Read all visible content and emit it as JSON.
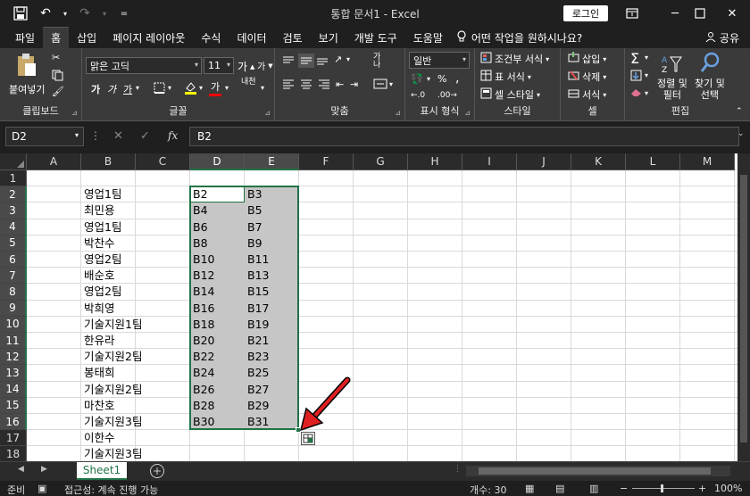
{
  "window": {
    "title": "통합 문서1 - Excel",
    "login_label": "로그인"
  },
  "ribbon": {
    "tabs": [
      "파일",
      "홈",
      "삽입",
      "페이지 레이아웃",
      "수식",
      "데이터",
      "검토",
      "보기",
      "개발 도구",
      "도움말"
    ],
    "active_tab": "홈",
    "tell_me": "어떤 작업을 원하시나요?",
    "share_label": "공유",
    "clipboard": {
      "paste_label": "붙여넣기",
      "group_label": "클립보드"
    },
    "font": {
      "font_name": "맑은 고딕",
      "font_size": "11",
      "bold": "가",
      "italic": "가",
      "underline": "가",
      "font_color_glyph": "가",
      "phonetic": "내천",
      "group_label": "글꼴"
    },
    "alignment": {
      "group_label": "맞춤",
      "wrap_glyph": "가나"
    },
    "number": {
      "format": "일반",
      "percent": "%",
      "comma": ",",
      "group_label": "표시 형식"
    },
    "styles": {
      "conditional": "조건부 서식",
      "table": "표 서식",
      "cell_style": "셀 스타일",
      "group_label": "스타일"
    },
    "cells": {
      "insert": "삽입",
      "delete": "삭제",
      "format": "서식",
      "group_label": "셀"
    },
    "editing": {
      "sort_filter": "정렬 및\n필터",
      "sort_line1": "정렬 및",
      "sort_line2": "필터",
      "find_line1": "찾기 및",
      "find_line2": "선택",
      "group_label": "편집"
    }
  },
  "formula_bar": {
    "name_box": "D2",
    "formula": "B2"
  },
  "grid": {
    "columns": [
      "A",
      "B",
      "C",
      "D",
      "E",
      "F",
      "G",
      "H",
      "I",
      "J",
      "K",
      "L",
      "M"
    ],
    "selected_columns": [
      "D",
      "E"
    ],
    "rows": [
      "1",
      "2",
      "3",
      "4",
      "5",
      "6",
      "7",
      "8",
      "9",
      "10",
      "11",
      "12",
      "13",
      "14",
      "15",
      "16",
      "17",
      "18"
    ],
    "selected_rows": [
      "2",
      "3",
      "4",
      "5",
      "6",
      "7",
      "8",
      "9",
      "10",
      "11",
      "12",
      "13",
      "14",
      "15",
      "16"
    ],
    "column_b": [
      "",
      "영업1팀",
      "최민용",
      "영업1팀",
      "박찬수",
      "영업2팀",
      "배순호",
      "영업2팀",
      "박희영",
      "기술지원1팀",
      "한유라",
      "기술지원2팀",
      "봉태희",
      "기술지원2팀",
      "마찬호",
      "기술지원3팀",
      "이한수",
      "기술지원3팀"
    ],
    "column_d": [
      "",
      "B2",
      "B4",
      "B6",
      "B8",
      "B10",
      "B12",
      "B14",
      "B16",
      "B18",
      "B20",
      "B22",
      "B24",
      "B26",
      "B28",
      "B30",
      "",
      ""
    ],
    "column_e": [
      "",
      "B3",
      "B5",
      "B7",
      "B9",
      "B11",
      "B13",
      "B15",
      "B17",
      "B19",
      "B21",
      "B23",
      "B25",
      "B27",
      "B29",
      "B31",
      "",
      ""
    ]
  },
  "sheets": {
    "tabs": [
      "Sheet1"
    ],
    "active": "Sheet1"
  },
  "status": {
    "mode": "준비",
    "accessibility": "접근성: 계속 진행 가능",
    "count": "개수: 30",
    "zoom": "100%"
  },
  "colors": {
    "accent": "#217346",
    "selection": "#c6c6c6",
    "arrow": "#e02020"
  }
}
